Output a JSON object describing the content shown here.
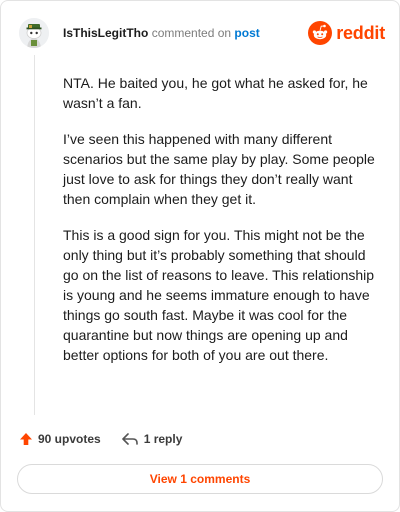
{
  "comment": {
    "username": "IsThisLegitTho",
    "commented_text": "commented on",
    "post_link": "post",
    "paragraphs": [
      "NTA. He baited you, he got what he asked for, he wasn’t a fan.",
      "I’ve seen this happened with many different scenarios but the same play by play. Some people just love to ask for things they don’t really want then complain when they get it.",
      "This is a good sign for you. This might not be the only thing but it’s probably something that should go on the list of reasons to leave. This relationship is young and he seems immature enough to have things go south fast. Maybe it was cool for the quarantine but now things are opening up and better options for both of you are out there."
    ]
  },
  "brand": {
    "wordmark": "reddit",
    "color": "#ff4500"
  },
  "actions": {
    "upvotes": "90 upvotes",
    "reply": "1 reply"
  },
  "view_comments": "View 1 comments",
  "icons": {
    "avatar": "avatar",
    "logo": "reddit-logo-icon",
    "upvote": "upvote-arrow-icon",
    "reply": "reply-arrow-icon"
  },
  "colors": {
    "accent": "#ff4500",
    "link": "#0079d3"
  }
}
